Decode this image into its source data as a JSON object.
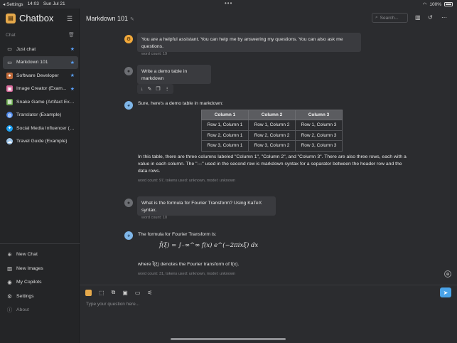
{
  "statusbar": {
    "carrier": "◂ Settings",
    "time": "14:03",
    "date": "Sun Jul 21",
    "dots": "•••",
    "wifi": "wifi-icon",
    "battery_pct": "100%"
  },
  "sidebar": {
    "app_name": "Chatbox",
    "section_label": "Chat",
    "sessions": [
      {
        "name": "Just chat",
        "icon": "chat-icon",
        "starred": true
      },
      {
        "name": "Markdown 101",
        "icon": "chat-icon",
        "starred": true,
        "active": true
      },
      {
        "name": "Software Developer",
        "icon": "avatar-icon",
        "starred": true
      },
      {
        "name": "Image Creator (Exam...",
        "icon": "image-icon",
        "starred": true
      },
      {
        "name": "Snake Game (Artifact Exa...",
        "icon": "game-icon",
        "starred": false
      },
      {
        "name": "Translator (Example)",
        "icon": "globe-icon",
        "starred": false
      },
      {
        "name": "Social Media Influencer (E...",
        "icon": "bird-icon",
        "starred": false
      },
      {
        "name": "Travel Guide (Example)",
        "icon": "cloud-icon",
        "starred": false
      }
    ],
    "bottom": [
      {
        "label": "New Chat",
        "icon": "plus-circle-icon"
      },
      {
        "label": "New Images",
        "icon": "image-add-icon"
      },
      {
        "label": "My Copilots",
        "icon": "copilot-icon"
      },
      {
        "label": "Settings",
        "icon": "gear-icon"
      },
      {
        "label": "About",
        "icon": "info-icon"
      }
    ]
  },
  "header": {
    "title": "Markdown 101",
    "search_placeholder": "Search..."
  },
  "messages": {
    "system": {
      "text": "You are a helpful assistant. You can help me by answering my questions. You can also ask me questions.",
      "meta": "word count: 19"
    },
    "user1": {
      "text": "Write a demo table in markdown",
      "meta": "word count: 6"
    },
    "bot1": {
      "intro": "Sure, here's a demo table in markdown:",
      "table": {
        "headers": [
          "Column 1",
          "Column 2",
          "Column 3"
        ],
        "rows": [
          [
            "Row 1, Column 1",
            "Row 1, Column 2",
            "Row 1, Column 3"
          ],
          [
            "Row 2, Column 1",
            "Row 2, Column 2",
            "Row 2, Column 3"
          ],
          [
            "Row 3, Column 1",
            "Row 3, Column 2",
            "Row 3, Column 3"
          ]
        ]
      },
      "outro": "In this table, there are three columns labeled \"Column 1\", \"Column 2\", and \"Column 3\". There are also three rows, each with a value in each column. The \"---\" used in the second row is markdown syntax for a separator between the header row and the data rows.",
      "meta": "word count: 97, tokens used: unknown, model: unknown"
    },
    "user2": {
      "text": "What is the formula for Fourier Transform? Using KaTeX syntax.",
      "meta": "word count: 10"
    },
    "bot2": {
      "intro": "The formula for Fourier Transform is:",
      "formula": "f̂(ξ) = ∫₋∞^∞ f(x) e^(−2πixξ) dx",
      "outro": "where f̂(ξ) denotes the Fourier transform of f(x).",
      "meta": "word count: 31, tokens used: unknown, model: unknown"
    }
  },
  "composer": {
    "placeholder": "Type your question here..."
  }
}
